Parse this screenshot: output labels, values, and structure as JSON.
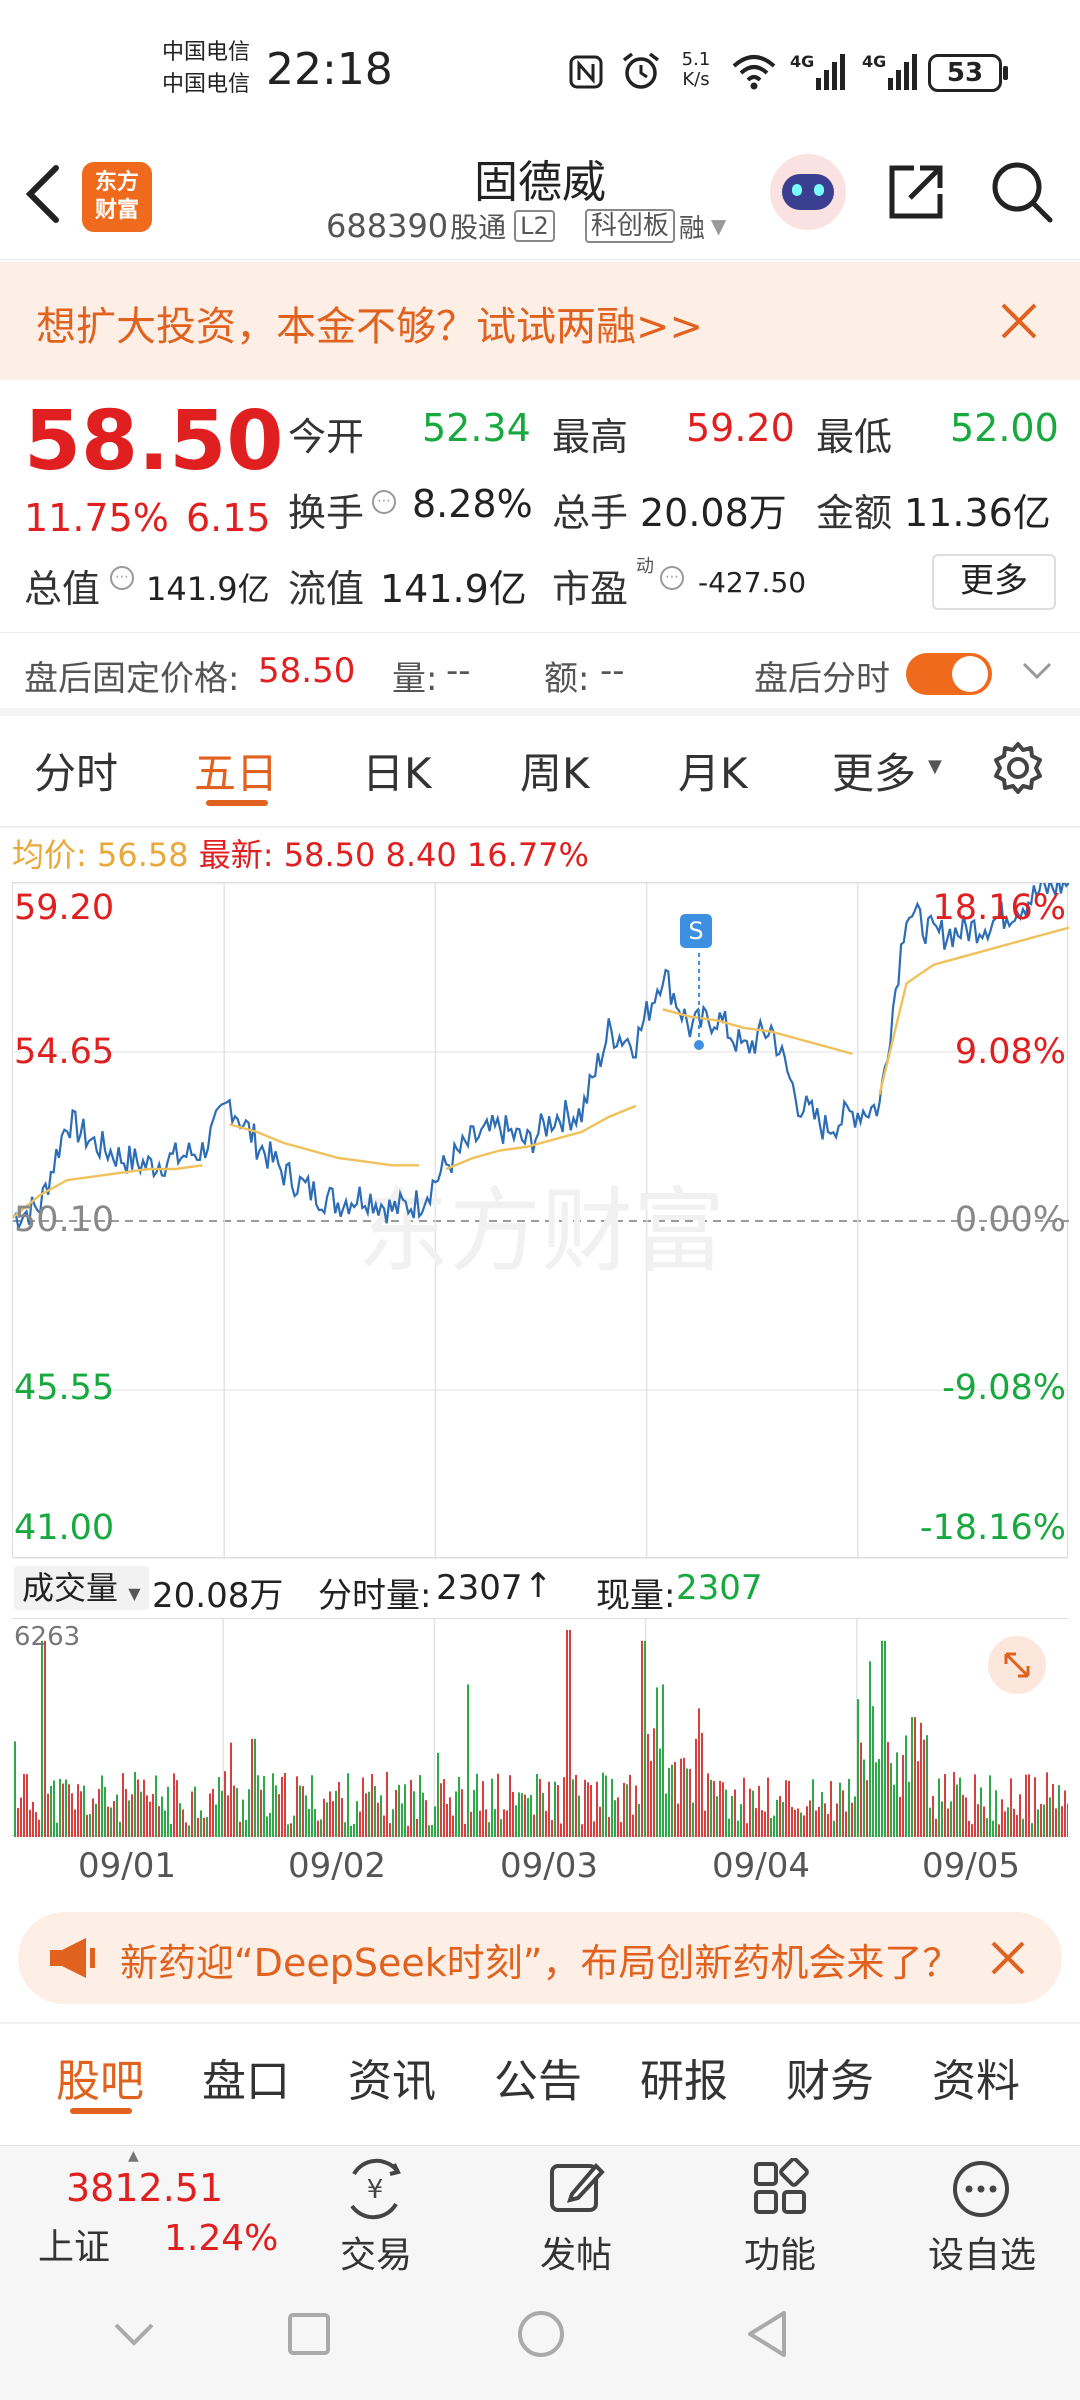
{
  "status_bar": {
    "carrier1": "中国电信",
    "carrier2": "中国电信",
    "time": "22:18",
    "net_speed_top": "5.1",
    "net_speed_bottom": "K/s",
    "signal1": "4G",
    "signal2": "4G",
    "battery": "53"
  },
  "header": {
    "logo_text_1": "东方",
    "logo_text_2": "财富",
    "stock_name": "固德威",
    "stock_code": "688390",
    "badge_gutong": "股通",
    "badge_l2": "L2",
    "badge_kechuang": "科创板",
    "badge_rong": "融"
  },
  "promo": {
    "text": "想扩大投资，本金不够？试试两融>>"
  },
  "quote": {
    "price": "58.50",
    "change_pct": "11.75%",
    "change": "6.15",
    "open_label": "今开",
    "open": "52.34",
    "high_label": "最高",
    "high": "59.20",
    "low_label": "最低",
    "low": "52.00",
    "turnover_label": "换手",
    "turnover": "8.28%",
    "volume_label": "总手",
    "volume": "20.08万",
    "amount_label": "金额",
    "amount": "11.36亿",
    "mktcap_label": "总值",
    "mktcap": "141.9亿",
    "float_label": "流值",
    "float_cap": "141.9亿",
    "pe_label": "市盈",
    "pe_sup": "动",
    "pe": "-427.50",
    "more_button": "更多"
  },
  "after_hours": {
    "price_label": "盘后固定价格:",
    "price": "58.50",
    "vol_label": "量:",
    "vol": "--",
    "amt_label": "额:",
    "amt": "--",
    "toggle_label": "盘后分时"
  },
  "tabs": [
    "分时",
    "五日",
    "日K",
    "周K",
    "月K",
    "更多"
  ],
  "active_tab": "五日",
  "chart_info": {
    "avg_label": "均价:",
    "avg": "56.58",
    "latest_label": "最新:",
    "latest": "58.50",
    "latest_change": "8.40",
    "latest_pct": "16.77%"
  },
  "chart_data": {
    "type": "line",
    "y_left_labels": [
      "59.20",
      "54.65",
      "50.10",
      "45.55",
      "41.00"
    ],
    "y_right_labels": [
      "18.16%",
      "9.08%",
      "0.00%",
      "-9.08%",
      "-18.16%"
    ],
    "ylim": [
      41.0,
      59.2
    ],
    "reference": 50.1,
    "x_labels": [
      "09/01",
      "09/02",
      "09/03",
      "09/04",
      "09/05"
    ],
    "watermark": "东方财富",
    "marker_label": "S",
    "series": [
      {
        "name": "price",
        "color": "#2d6db5",
        "values": [
          50.2,
          50.5,
          52.8,
          52.2,
          51.8,
          51.6,
          51.8,
          52.0,
          53.3,
          52.2,
          51.4,
          50.9,
          50.6,
          50.8,
          50.4,
          50.6,
          51.6,
          52.3,
          52.6,
          52.2,
          52.9,
          53.0,
          55.2,
          54.9,
          56.8,
          55.3,
          55.6,
          54.7,
          55.3,
          53.3,
          52.6,
          53.0,
          53.2,
          58.5,
          57.8,
          57.9,
          58.1,
          58.5,
          59.0,
          59.2
        ]
      },
      {
        "name": "avg",
        "color": "#f0c15a",
        "values": [
          50.2,
          50.8,
          51.2,
          51.3,
          51.4,
          51.5,
          51.5,
          51.6,
          52.7,
          52.5,
          52.2,
          52.0,
          51.8,
          51.7,
          51.6,
          51.6,
          51.5,
          51.8,
          52.0,
          52.1,
          52.3,
          52.5,
          52.9,
          53.2,
          55.8,
          55.6,
          55.5,
          55.3,
          55.2,
          55.0,
          54.8,
          54.6,
          53.5,
          56.5,
          57.0,
          57.2,
          57.4,
          57.6,
          57.8,
          58.0
        ]
      }
    ]
  },
  "volume_bar": {
    "label": "成交量",
    "total": "20.08万",
    "tick_label": "分时量:",
    "tick": "2307",
    "now_label": "现量:",
    "now": "2307",
    "max": "6263"
  },
  "news": {
    "text": "新药迎“DeepSeek时刻”，布局创新药机会来了？"
  },
  "bottom_tabs": [
    "股吧",
    "盘口",
    "资讯",
    "公告",
    "研报",
    "财务",
    "资料"
  ],
  "active_bottom_tab": "股吧",
  "bottom_bar": {
    "index_value": "3812.51",
    "index_name": "上证",
    "index_pct": "1.24%",
    "trade": "交易",
    "post": "发帖",
    "features": "功能",
    "watchlist": "设自选"
  }
}
